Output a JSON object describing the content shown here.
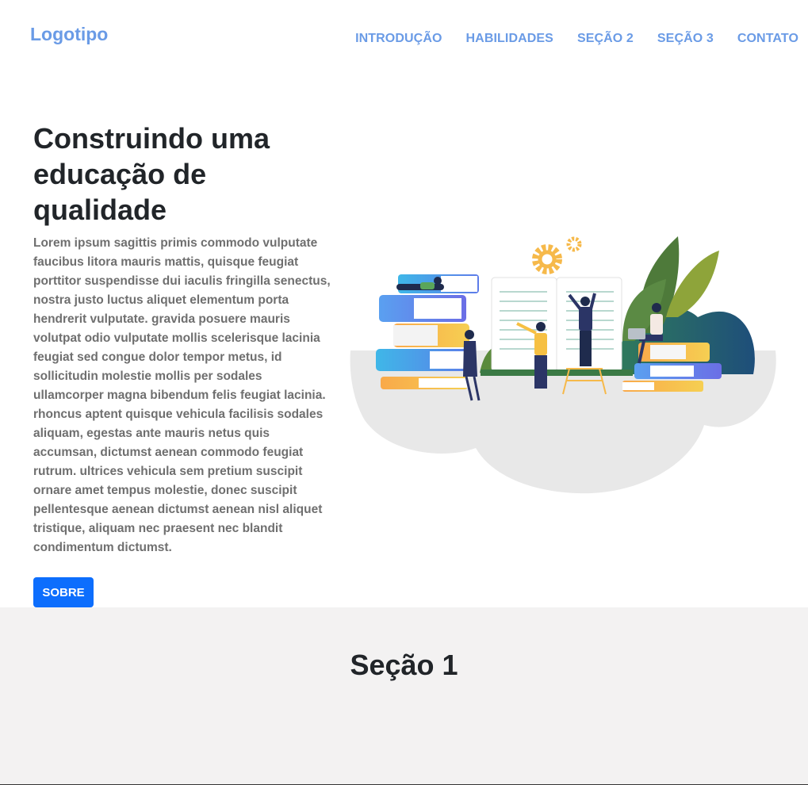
{
  "header": {
    "logo": "Logotipo",
    "nav": [
      "INTRODUÇÃO",
      "HABILIDADES",
      "SEÇÃO 2",
      "SEÇÃO 3",
      "CONTATO"
    ]
  },
  "hero": {
    "title": "Construindo uma educação de qualidade",
    "body": "Lorem ipsum sagittis primis commodo vulputate faucibus litora mauris mattis, quisque feugiat porttitor suspendisse dui iaculis fringilla senectus, nostra justo luctus aliquet elementum porta hendrerit vulputate. gravida posuere mauris volutpat odio vulputate mollis scelerisque lacinia feugiat sed congue dolor tempor metus, id sollicitudin molestie mollis per sodales ullamcorper magna bibendum felis feugiat lacinia. rhoncus aptent quisque vehicula facilisis sodales aliquam, egestas ante mauris netus quis accumsan, dictumst aenean commodo feugiat rutrum. ultrices vehicula sem pretium suscipit ornare amet tempus molestie, donec suscipit pellentesque aenean dictumst aenean nisl aliquet tristique, aliquam nec praesent nec blandit condimentum dictumst.",
    "button": "SOBRE"
  },
  "section1": {
    "title": "Seção 1"
  },
  "colors": {
    "link": "#6a9be6",
    "button": "#0d6efd",
    "section_bg": "#f3f2f2"
  }
}
